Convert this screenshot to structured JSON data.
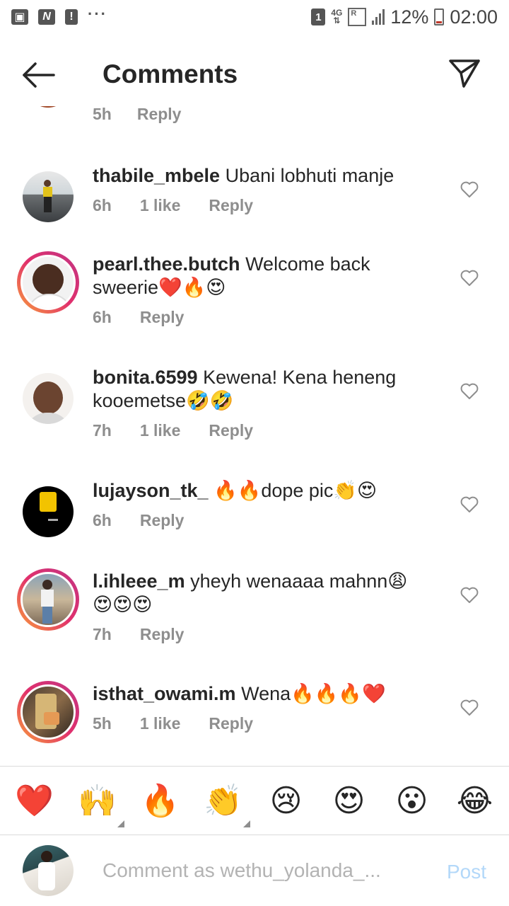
{
  "status_bar": {
    "sim_slot": "1",
    "network": "4G",
    "roaming": "R",
    "battery": "12%",
    "time": "02:00",
    "dots": "···"
  },
  "header": {
    "title": "Comments"
  },
  "partial_comment": {
    "time": "5h",
    "reply": "Reply"
  },
  "comments": [
    {
      "username": "thabile_mbele",
      "text": "Ubani lobhuti manje",
      "time": "6h",
      "likes": "1 like",
      "reply": "Reply"
    },
    {
      "username": "pearl.thee.butch",
      "text": "Welcome back sweerie❤️🔥😍",
      "time": "6h",
      "likes": "",
      "reply": "Reply"
    },
    {
      "username": "bonita.6599",
      "text": "Kewena! Kena heneng kooemetse🤣🤣",
      "time": "7h",
      "likes": "1 like",
      "reply": "Reply"
    },
    {
      "username": "lujayson_tk_",
      "text": "🔥🔥dope pic👏😍",
      "time": "6h",
      "likes": "",
      "reply": "Reply"
    },
    {
      "username": "l.ihleee_m",
      "text": "yheyh wenaaaa mahnn😩😍😍😍",
      "time": "7h",
      "likes": "",
      "reply": "Reply"
    },
    {
      "username": "isthat_owami.m",
      "text": "Wena🔥🔥🔥❤️",
      "time": "5h",
      "likes": "1 like",
      "reply": "Reply"
    }
  ],
  "emoji_bar": [
    "❤️",
    "🙌",
    "🔥",
    "👏",
    "😢",
    "😍",
    "😮",
    "😂"
  ],
  "composer": {
    "placeholder": "Comment as wethu_yolanda_...",
    "post_label": "Post"
  },
  "colors": {
    "text": "#262626",
    "meta": "#8e8e8e",
    "post_disabled": "#b3d8f9",
    "story_ring_start": "#f9a13a",
    "story_ring_end": "#c13584"
  }
}
